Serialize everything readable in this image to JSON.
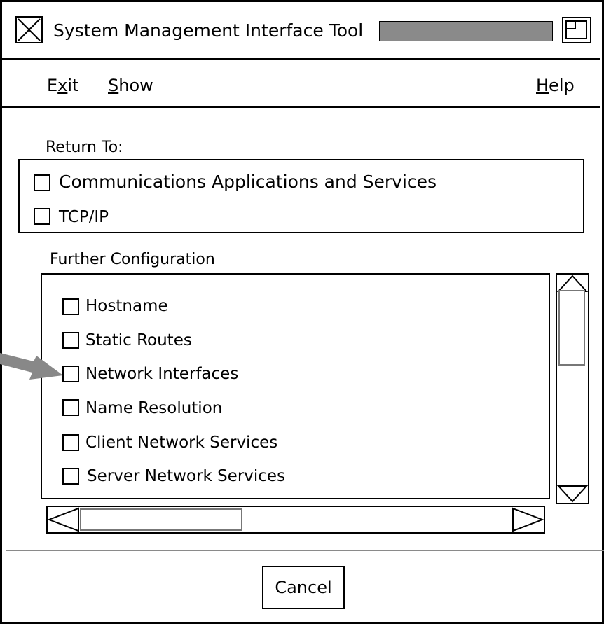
{
  "window": {
    "title": "System Management Interface Tool"
  },
  "menubar": {
    "exit": {
      "pre": "E",
      "mnemonic": "x",
      "post": "it"
    },
    "show": {
      "pre": "",
      "mnemonic": "S",
      "post": "how"
    },
    "help": {
      "pre": "",
      "mnemonic": "H",
      "post": "elp"
    }
  },
  "return_to": {
    "label": "Return To:",
    "items": [
      {
        "label": "Communications Applications and Services"
      },
      {
        "label": "TCP/IP"
      }
    ]
  },
  "further_configuration": {
    "label": "Further Configuration",
    "items": [
      {
        "label": "Hostname"
      },
      {
        "label": "Static Routes"
      },
      {
        "label": "Network Interfaces"
      },
      {
        "label": "Name Resolution"
      },
      {
        "label": "Client Network Services"
      },
      {
        "label": "Server Network Services"
      }
    ]
  },
  "footer": {
    "cancel_label": "Cancel"
  },
  "icons": {
    "close": "x-close-icon",
    "restore": "window-restore-icon",
    "scroll_up": "triangle-up-icon",
    "scroll_down": "triangle-down-icon",
    "scroll_left": "triangle-left-icon",
    "scroll_right": "triangle-right-icon",
    "callout_arrow": "arrow-right-icon"
  },
  "colors": {
    "title_bar_fill": "#8a8a8a",
    "callout_arrow": "#888888"
  }
}
